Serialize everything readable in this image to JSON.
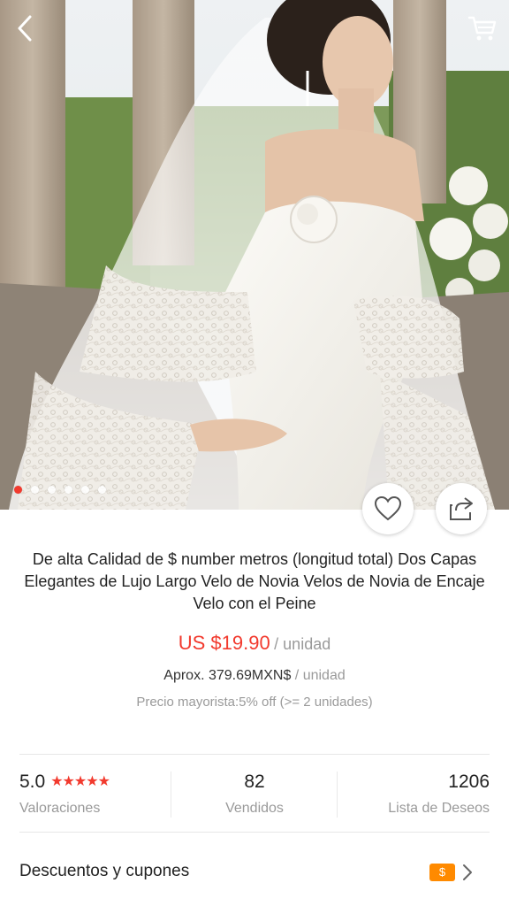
{
  "product": {
    "title": "De alta Calidad de $ number metros (longitud total) Dos Capas Elegantes de Lujo Largo Velo de Novia Velos de Novia de Encaje Velo con el Peine",
    "price": "US $19.90",
    "price_unit": "/ unidad",
    "approx_price": "Aprox. 379.69MXN$",
    "approx_unit": "/ unidad",
    "wholesale": "Precio mayorista:5% off (>= 2 unidades)"
  },
  "gallery": {
    "image_count": 6,
    "active_index": 0
  },
  "stats": {
    "rating": "5.0",
    "rating_label": "Valoraciones",
    "sold": "82",
    "sold_label": "Vendidos",
    "wishlist": "1206",
    "wishlist_label": "Lista de Deseos"
  },
  "coupons": {
    "label": "Descuentos y cupones",
    "badge": "$"
  },
  "icons": {
    "back": "chevron-left-icon",
    "cart": "cart-icon",
    "like": "heart-icon",
    "share": "share-icon",
    "chevron": "chevron-right-icon"
  },
  "colors": {
    "accent": "#f23a2e",
    "coupon": "#ff8a00",
    "muted": "#9a9a9a"
  }
}
